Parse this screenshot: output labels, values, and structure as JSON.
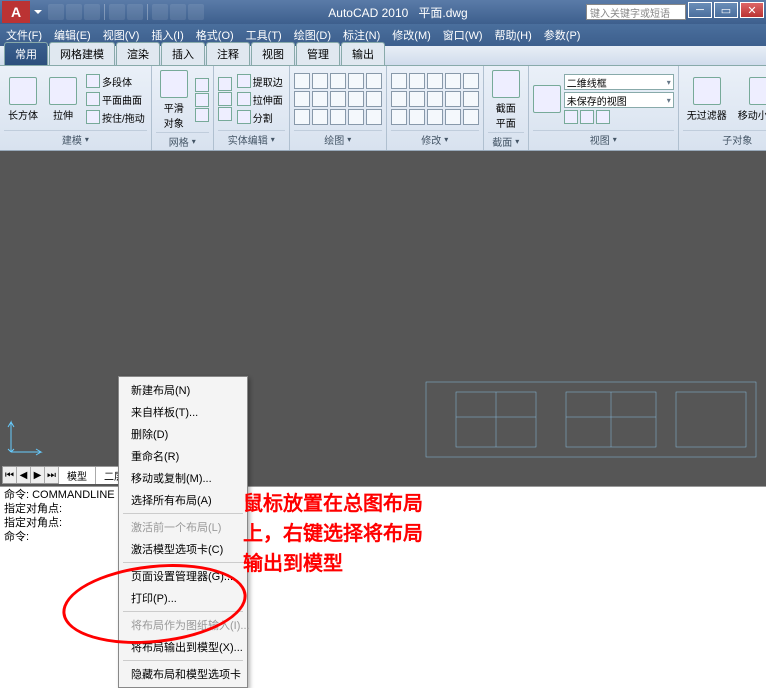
{
  "title": {
    "app": "AutoCAD 2010",
    "doc": "平面.dwg",
    "search_placeholder": "键入关键字或短语"
  },
  "menu": [
    "文件(F)",
    "编辑(E)",
    "视图(V)",
    "插入(I)",
    "格式(O)",
    "工具(T)",
    "绘图(D)",
    "标注(N)",
    "修改(M)",
    "窗口(W)",
    "帮助(H)",
    "参数(P)"
  ],
  "tabs": [
    "常用",
    "网格建模",
    "渲染",
    "插入",
    "注释",
    "视图",
    "管理",
    "输出"
  ],
  "active_tab": 0,
  "panels": {
    "p0": {
      "title": "建模",
      "btn0": "长方体",
      "btn1": "拉伸",
      "r0": "多段体",
      "r1": "平面曲面",
      "r2": "按住/拖动"
    },
    "p1": {
      "title": "网格",
      "btn0": "平滑\n对象"
    },
    "p2": {
      "title": "实体编辑",
      "r0": "提取边",
      "r1": "拉伸面",
      "r2": "分割"
    },
    "p3": {
      "title": "绘图"
    },
    "p4": {
      "title": "修改"
    },
    "p5": {
      "title": "截面",
      "btn0": "截面\n平面"
    },
    "p6": {
      "title": "视图",
      "combo0": "二维线框",
      "combo1": "未保存的视图"
    },
    "p7": {
      "title": "子对象",
      "btn0": "无过滤器",
      "btn1": "移动小控件"
    }
  },
  "context_menu": {
    "items": [
      "新建布局(N)",
      "来自样板(T)...",
      "删除(D)",
      "重命名(R)",
      "移动或复制(M)...",
      "选择所有布局(A)",
      "-",
      "激活前一个布局(L)",
      "激活模型选项卡(C)",
      "-",
      "页面设置管理器(G)...",
      "打印(P)...",
      "-",
      "将布局作为图纸输入(I)...",
      "将布局输出到模型(X)...",
      "-",
      "隐藏布局和模型选项卡"
    ],
    "disabled": [
      7,
      13
    ]
  },
  "annotation": {
    "l1": "鼠标放置在总图布局",
    "l2": "上，右键选择将布局",
    "l3": "输出到模型"
  },
  "model_tabs": {
    "t0": "模型",
    "t1": "二层总图"
  },
  "cmd": {
    "l0": "命令: COMMANDLINE",
    "l1": "指定对角点:",
    "l2": "指定对角点:",
    "l3": "命令:"
  }
}
